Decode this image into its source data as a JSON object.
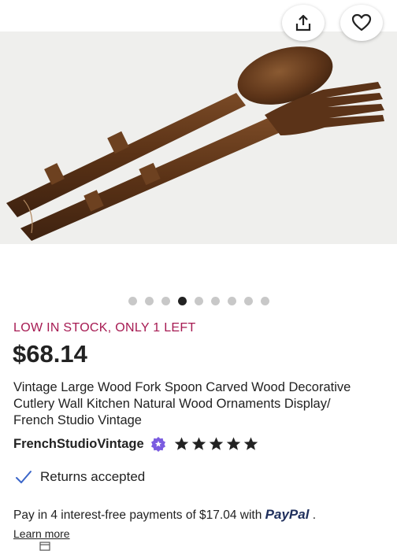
{
  "gallery": {
    "image_alt": "Wooden carved spoon and fork",
    "dot_count": 9,
    "active_dot": 3
  },
  "actions": {
    "share_icon": "share-icon",
    "favorite_icon": "heart-icon"
  },
  "listing": {
    "stock_notice": "LOW IN STOCK, ONLY 1 LEFT",
    "price": "$68.14",
    "title": "Vintage Large Wood Fork Spoon Carved Wood Decorative Cutlery Wall Kitchen Natural Wood Ornaments Display/ French Studio Vintage"
  },
  "shop": {
    "name": "FrenchStudioVintage",
    "badge_icon": "star-seller-badge-icon",
    "rating": 5,
    "rating_max": 5
  },
  "policies": {
    "returns": "Returns accepted"
  },
  "payment": {
    "installments_text": "Pay in 4 interest-free payments of $17.04 with",
    "brand": "PayPal",
    "suffix": ".",
    "learn_more": "Learn more"
  },
  "colors": {
    "stock": "#a61a52",
    "text": "#222222",
    "badge": "#7b5ce0",
    "paypal": "#1f2f5c"
  }
}
